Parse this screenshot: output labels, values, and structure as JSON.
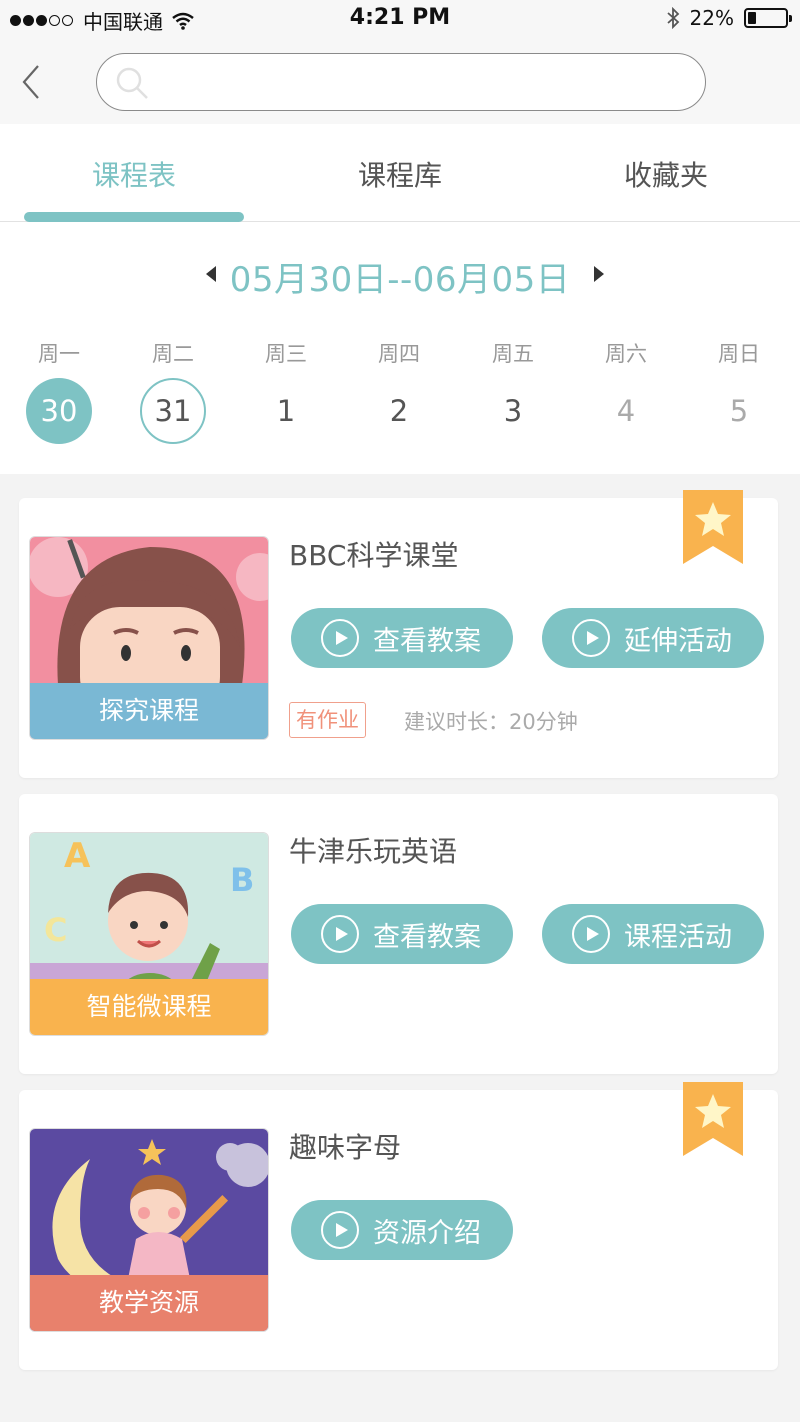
{
  "status_bar": {
    "carrier": "中国联通",
    "time": "4:21 PM",
    "battery": "22%",
    "battery_level": 0.22
  },
  "search": {
    "placeholder": ""
  },
  "tabs": [
    {
      "label": "课程表",
      "active": true
    },
    {
      "label": "课程库",
      "active": false
    },
    {
      "label": "收藏夹",
      "active": false
    }
  ],
  "week": {
    "range": "05月30日--06月05日",
    "days": [
      {
        "weekday": "周一",
        "date": "30",
        "state": "today"
      },
      {
        "weekday": "周二",
        "date": "31",
        "state": "selected"
      },
      {
        "weekday": "周三",
        "date": "1",
        "state": "normal"
      },
      {
        "weekday": "周四",
        "date": "2",
        "state": "normal"
      },
      {
        "weekday": "周五",
        "date": "3",
        "state": "normal"
      },
      {
        "weekday": "周六",
        "date": "4",
        "state": "weekend"
      },
      {
        "weekday": "周日",
        "date": "5",
        "state": "weekend"
      }
    ]
  },
  "courses": [
    {
      "title": "BBC科学课堂",
      "category": "探究课程",
      "category_color": "#7ab8d4",
      "buttons": [
        "查看教案",
        "延伸活动"
      ],
      "homework_tag": "有作业",
      "duration": "建议时长：20分钟",
      "favorited": true
    },
    {
      "title": "牛津乐玩英语",
      "category": "智能微课程",
      "category_color": "#f9b34e",
      "buttons": [
        "查看教案",
        "课程活动"
      ],
      "favorited": false
    },
    {
      "title": "趣味字母",
      "category": "教学资源",
      "category_color": "#e8816c",
      "buttons": [
        "资源介绍"
      ],
      "favorited": true
    }
  ],
  "colors": {
    "accent": "#7ec3c4",
    "ribbon": "#f9b34e"
  }
}
